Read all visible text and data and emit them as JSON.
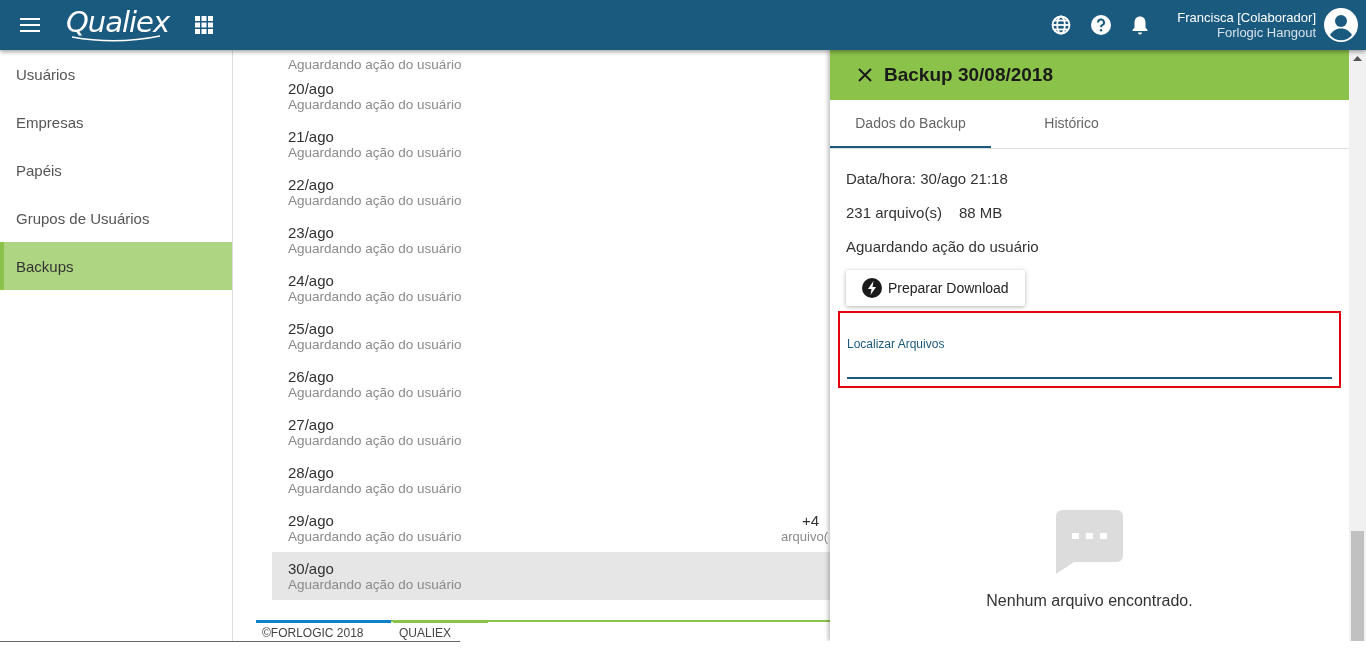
{
  "header": {
    "logo": "Qualiex",
    "user_name": "Francisca [Colaborador]",
    "user_org": "Forlogic Hangout"
  },
  "sidebar": {
    "items": [
      {
        "label": "Usuários",
        "selected": false
      },
      {
        "label": "Empresas",
        "selected": false
      },
      {
        "label": "Papéis",
        "selected": false
      },
      {
        "label": "Grupos de Usuários",
        "selected": false
      },
      {
        "label": "Backups",
        "selected": true
      }
    ]
  },
  "backups": {
    "rows": [
      {
        "subtitle": "Aguardando ação do usuário",
        "selected": false
      },
      {
        "title": "20/ago",
        "subtitle": "Aguardando ação do usuário",
        "selected": false
      },
      {
        "title": "21/ago",
        "subtitle": "Aguardando ação do usuário",
        "selected": false
      },
      {
        "title": "22/ago",
        "subtitle": "Aguardando ação do usuário",
        "selected": false
      },
      {
        "title": "23/ago",
        "subtitle": "Aguardando ação do usuário",
        "selected": false
      },
      {
        "title": "24/ago",
        "subtitle": "Aguardando ação do usuário",
        "selected": false
      },
      {
        "title": "25/ago",
        "subtitle": "Aguardando ação do usuário",
        "selected": false
      },
      {
        "title": "26/ago",
        "subtitle": "Aguardando ação do usuário",
        "selected": false
      },
      {
        "title": "27/ago",
        "subtitle": "Aguardando ação do usuário",
        "selected": false
      },
      {
        "title": "28/ago",
        "subtitle": "Aguardando ação do usuário",
        "selected": false
      },
      {
        "title": "29/ago",
        "subtitle": "Aguardando ação do usuário",
        "selected": false,
        "count": "+4",
        "count_label": "arquivo("
      },
      {
        "title": "30/ago",
        "subtitle": "Aguardando ação do usuário",
        "selected": true
      }
    ]
  },
  "footer": {
    "copyright": "©FORLOGIC 2018",
    "product": "QUALIEX"
  },
  "panel": {
    "title": "Backup 30/08/2018",
    "tabs": [
      {
        "label": "Dados do Backup",
        "selected": true
      },
      {
        "label": "Histórico",
        "selected": false
      }
    ],
    "datetime": "Data/hora: 30/ago 21:18",
    "files": "231 arquivo(s)",
    "size": "88 MB",
    "status": "Aguardando ação do usuário",
    "button": "Preparar Download",
    "search": {
      "label": "Localizar Arquivos",
      "highlighted": true
    },
    "empty_message": "Nenhum arquivo encontrado."
  }
}
